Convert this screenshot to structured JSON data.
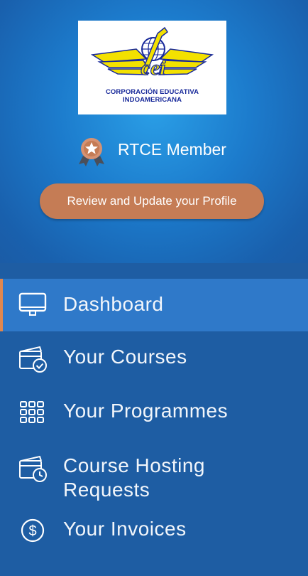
{
  "logo": {
    "brand_text": "cei",
    "line1": "CORPORACIÓN EDUCATIVA",
    "line2": "INDOAMERICANA"
  },
  "membership": {
    "label": "RTCE Member",
    "badge_icon": "medal-star-icon"
  },
  "profile_button": {
    "label": "Review and Update your Profile"
  },
  "nav": {
    "items": [
      {
        "label": "Dashboard",
        "icon": "monitor-icon",
        "active": true
      },
      {
        "label": "Your Courses",
        "icon": "calendar-check-icon",
        "active": false
      },
      {
        "label": "Your Programmes",
        "icon": "grid-icon",
        "active": false
      },
      {
        "label": "Course Hosting Requests",
        "line1": "Course Hosting",
        "line2": "Requests",
        "icon": "calendar-clock-icon",
        "active": false
      },
      {
        "label": "Your Invoices",
        "icon": "dollar-circle-icon",
        "active": false
      }
    ]
  },
  "colors": {
    "header_gradient_center": "#2a9ee6",
    "sidebar_bg": "#1e5da3",
    "active_item_bg": "#2f79c9",
    "active_indicator": "#e0874e",
    "profile_button_bg": "#c57c55",
    "logo_yellow": "#f3e100",
    "logo_blue": "#18299a"
  }
}
